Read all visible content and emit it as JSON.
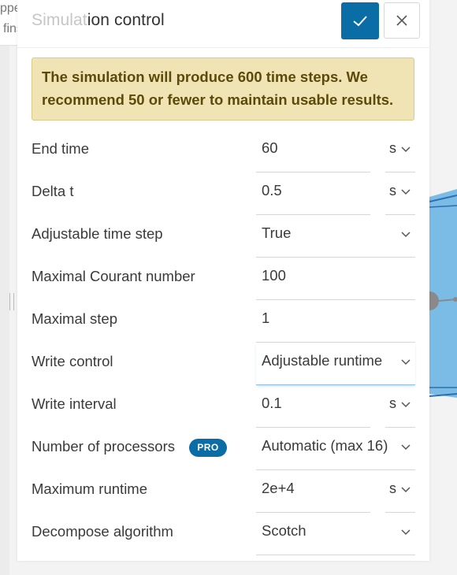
{
  "background": {
    "tree_line1": "pper bus bar",
    "tree_line2": "fins"
  },
  "panel": {
    "title_faded": "Simulat",
    "title_rest": "ion control",
    "confirm_icon": "check-icon",
    "close_icon": "close-icon",
    "warning": "The simulation will produce 600 time steps. We recommend 50 or fewer to maintain usable results."
  },
  "fields": [
    {
      "label": "End time",
      "value": "60",
      "unit": "s"
    },
    {
      "label": "Delta t",
      "value": "0.5",
      "unit": "s"
    },
    {
      "label": "Adjustable time step",
      "value": "True"
    },
    {
      "label": "Maximal Courant number",
      "value": "100"
    },
    {
      "label": "Maximal step",
      "value": "1"
    },
    {
      "label": "Write control",
      "value": "Adjustable runtime"
    },
    {
      "label": "Write interval",
      "value": "0.1",
      "unit": "s"
    },
    {
      "label": "Number of processors",
      "value": "Automatic (max 16)",
      "badge": "PRO"
    },
    {
      "label": "Maximum runtime",
      "value": "2e+4",
      "unit": "s"
    },
    {
      "label": "Decompose algorithm",
      "value": "Scotch"
    }
  ],
  "colors": {
    "primary": "#0b6da6",
    "warning_bg": "#f0e4b4",
    "scene_blue": "#7bbce6"
  }
}
